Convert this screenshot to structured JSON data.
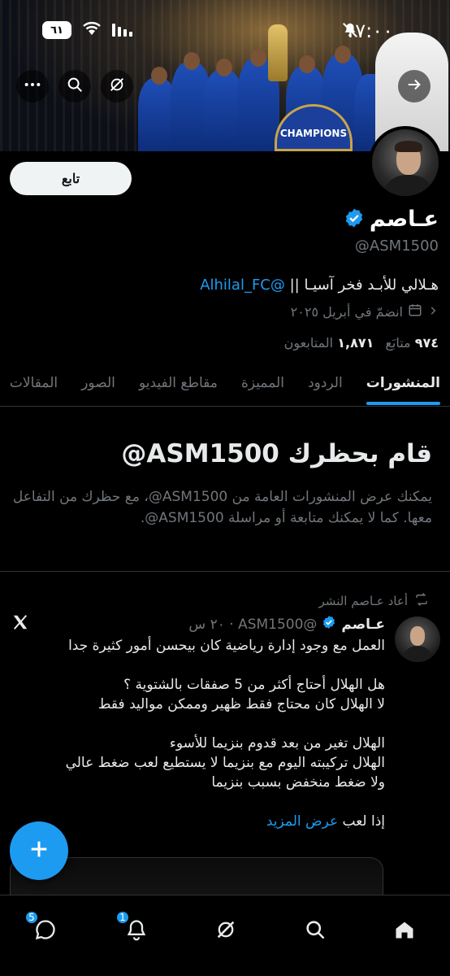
{
  "status_bar": {
    "time": "١٧:٠٠",
    "battery": "٦١"
  },
  "header": {
    "follow_label": "تابع"
  },
  "profile": {
    "name": "عـاصم",
    "handle": "@ASM1500",
    "bio_text": "هـلالي للأبـد فخر آسيـا || ",
    "bio_link": "@Alhilal_FC",
    "joined": "انضمّ في أبريل ٢٠٢٥",
    "following_count": "٩٧٤",
    "following_label": "متابَع",
    "followers_count": "١,٨٧١",
    "followers_label": "المتابعون"
  },
  "tabs": [
    {
      "label": "المنشورات",
      "active": true
    },
    {
      "label": "الردود"
    },
    {
      "label": "المميزة"
    },
    {
      "label": "مقاطع الفيديو"
    },
    {
      "label": "الصور"
    },
    {
      "label": "المقالات"
    }
  ],
  "blocked": {
    "title": "قام بحظرك ASM1500@",
    "description": "يمكنك عرض المنشورات العامة من ASM1500@، مع حظرك من التفاعل معها. كما لا يمكنك متابعة أو مراسلة ASM1500@."
  },
  "tweet": {
    "repost_label": "أعاد عـاصم النشر",
    "name": "عـاصم",
    "handle_time": "@ASM1500 · ٢٠ س",
    "lines": [
      "العمل مع وجود إدارة رياضية كان بيحسن أمور كثيرة جدا",
      "",
      "هل الهلال أحتاج أكثر من 5 صفقات بالشتوية ؟",
      "لا الهلال كان محتاج فقط ظهير وممكن مواليد فقط",
      "",
      "الهلال تغير من بعد قدوم بنزيما للأسوء",
      "الهلال تركيبته اليوم مع بنزيما لا يستطيع لعب ضغط عالي",
      "ولا ضغط منخفض بسبب بنزيما",
      ""
    ],
    "last_line": "إذا لعب ",
    "show_more": "عرض المزيد"
  },
  "bottom_nav": {
    "messages_badge": "5",
    "notifications_badge": "1"
  },
  "icons": {
    "back": "arrow-right-icon",
    "more": "more-dots-icon",
    "search": "search-icon",
    "grok": "grok-icon"
  },
  "colors": {
    "accent": "#1d9bf0",
    "muted": "#71767b",
    "text": "#e7e9ea"
  }
}
